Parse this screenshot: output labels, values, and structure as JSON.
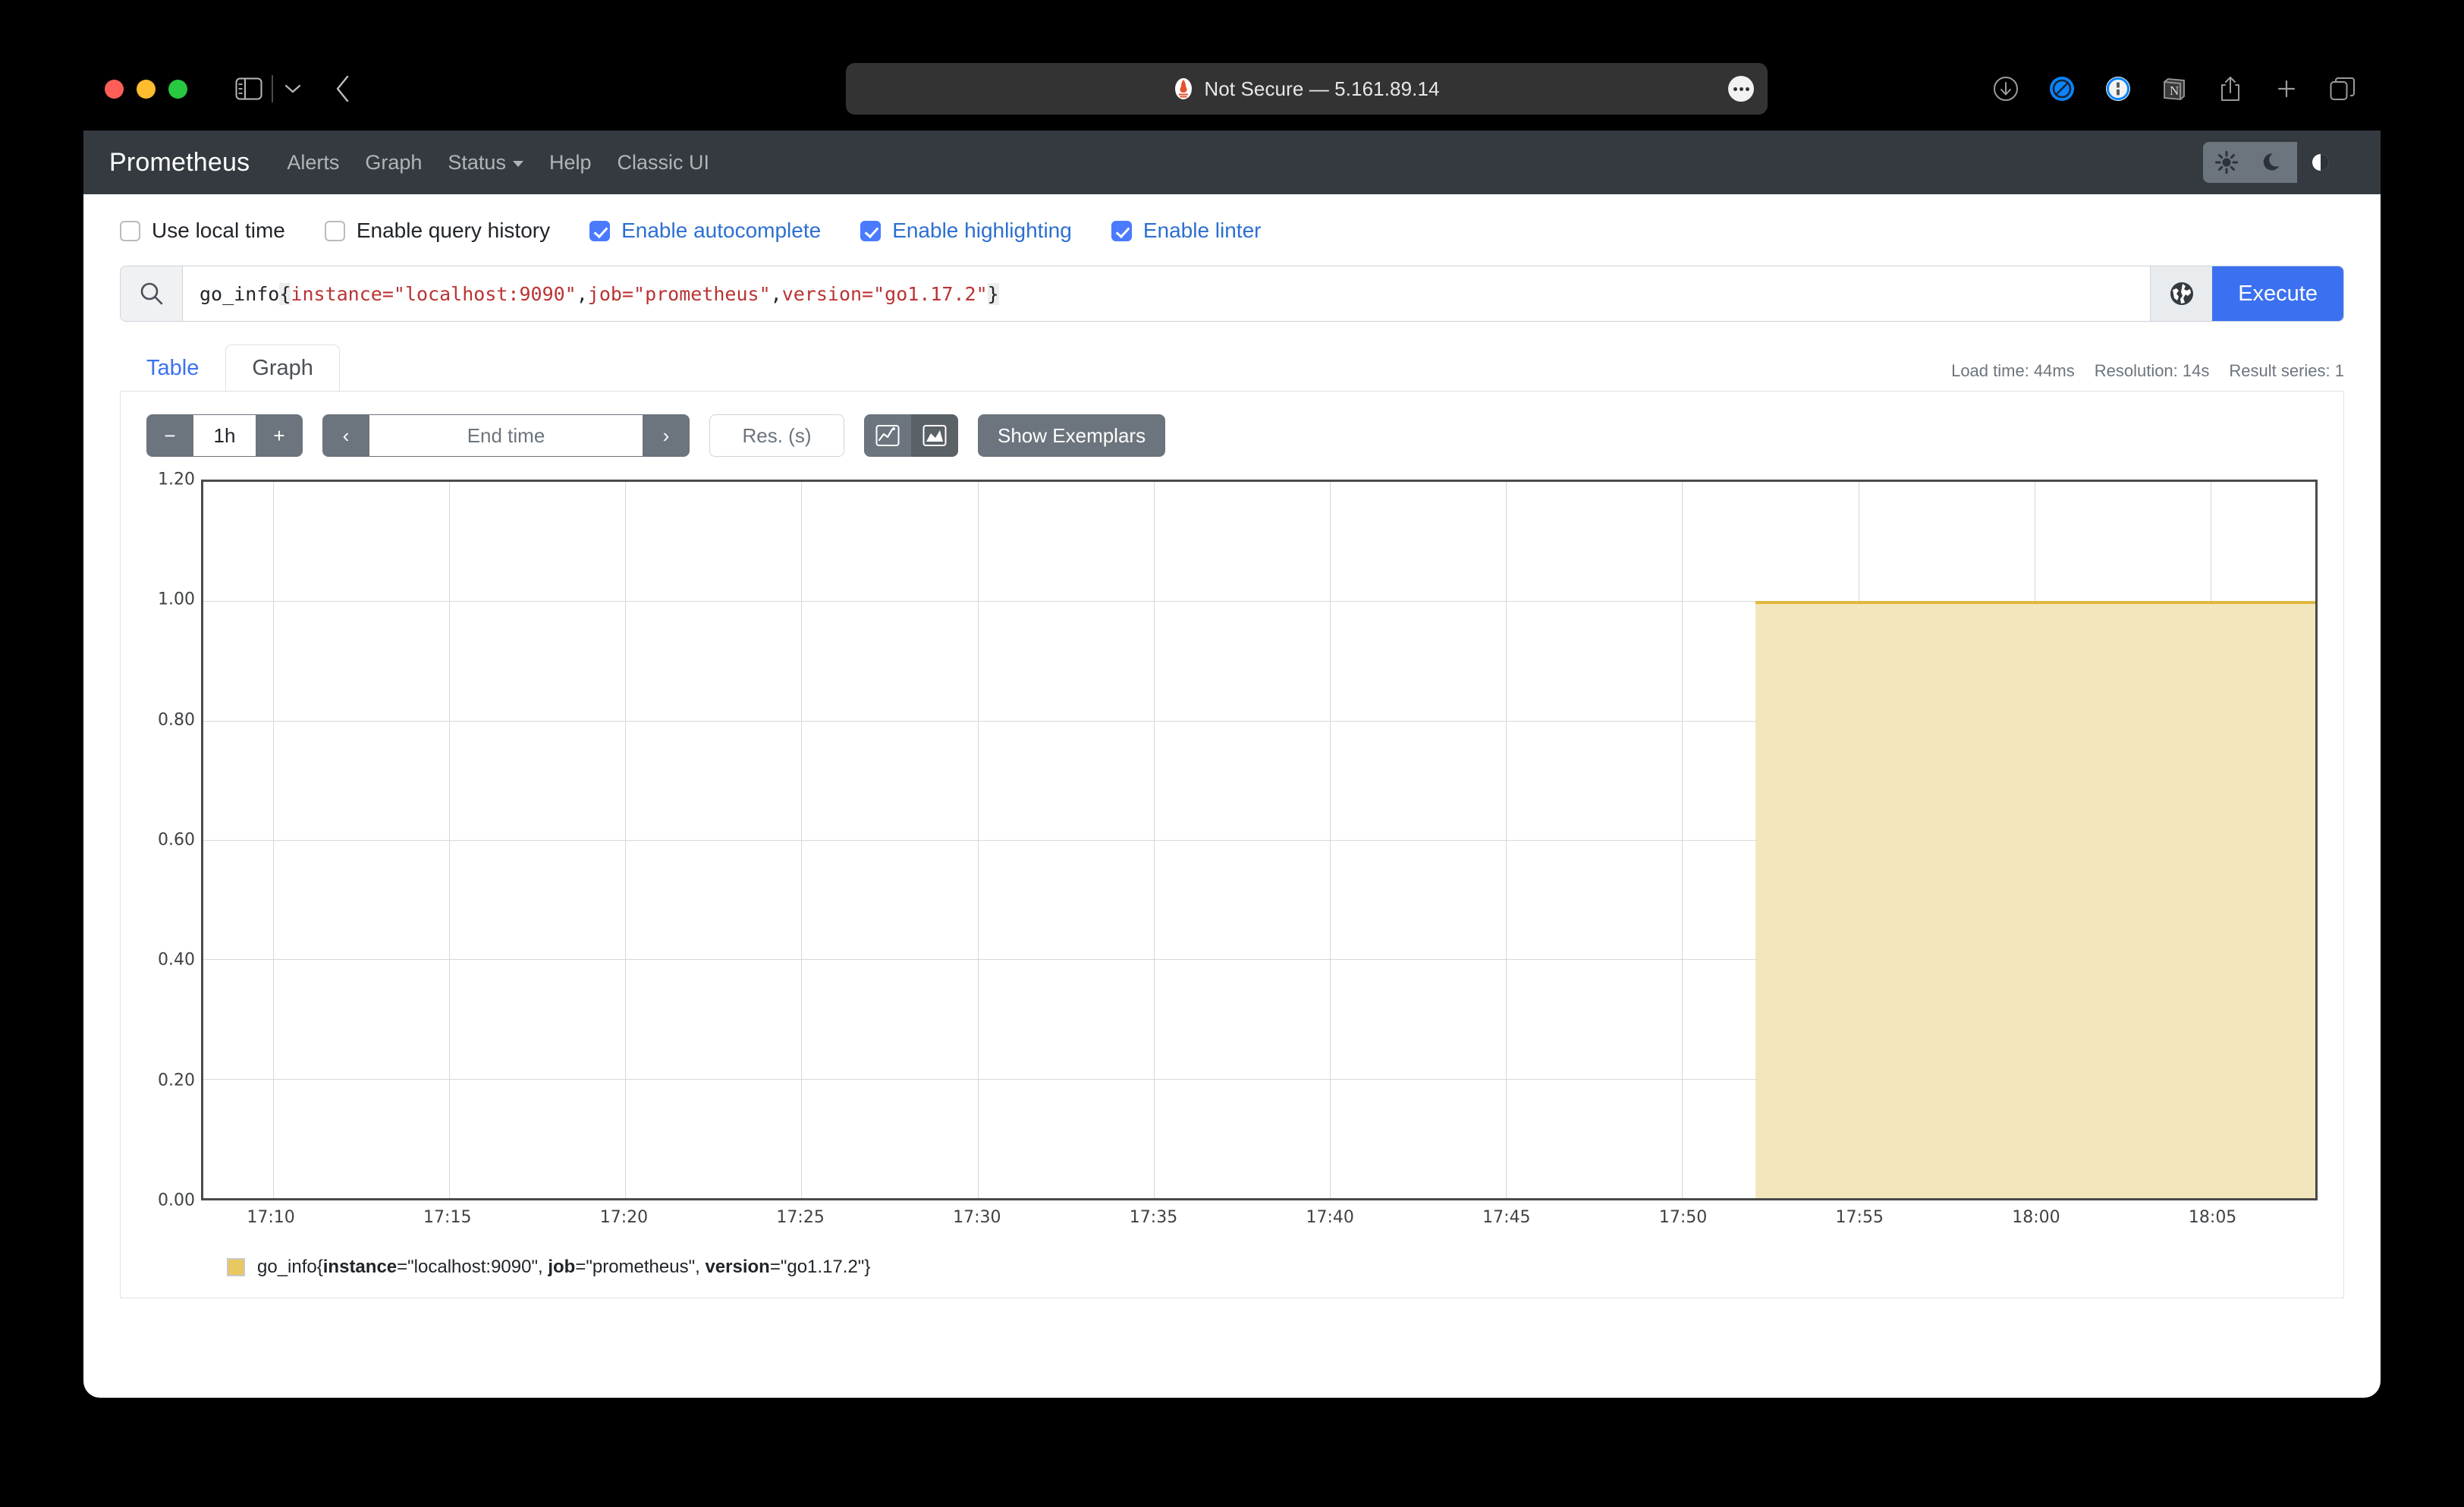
{
  "browser": {
    "url_label": "Not Secure — 5.161.89.14",
    "favicon_name": "prometheus-favicon",
    "toolbar_icons": [
      "download-icon",
      "adblock-icon",
      "1password-icon",
      "notion-icon",
      "share-icon",
      "new-tab-icon",
      "tab-overview-icon"
    ],
    "left_icons": [
      "sidebar-toggle-icon",
      "tab-group-chevron-icon",
      "back-arrow-icon"
    ]
  },
  "navbar": {
    "brand": "Prometheus",
    "links": [
      {
        "label": "Alerts",
        "caret": false
      },
      {
        "label": "Graph",
        "caret": false
      },
      {
        "label": "Status",
        "caret": true
      },
      {
        "label": "Help",
        "caret": false
      },
      {
        "label": "Classic UI",
        "caret": false
      }
    ],
    "theme_buttons": [
      {
        "name": "light-theme-button",
        "icon": "sun-icon",
        "active": false
      },
      {
        "name": "dark-theme-button",
        "icon": "moon-icon",
        "active": false
      },
      {
        "name": "auto-theme-button",
        "icon": "contrast-icon",
        "active": true
      }
    ]
  },
  "options": [
    {
      "label": "Use local time",
      "checked": false
    },
    {
      "label": "Enable query history",
      "checked": false
    },
    {
      "label": "Enable autocomplete",
      "checked": true
    },
    {
      "label": "Enable highlighting",
      "checked": true
    },
    {
      "label": "Enable linter",
      "checked": true
    }
  ],
  "query": {
    "full_text": "go_info{instance=\"localhost:9090\", job=\"prometheus\", version=\"go1.17.2\"}",
    "metric": "go_info",
    "open_brace": "{",
    "close_brace": "}",
    "tokens": [
      {
        "name": "instance",
        "op": "=",
        "value": "\"localhost:9090\""
      },
      {
        "name": "job",
        "op": "=",
        "value": "\"prometheus\""
      },
      {
        "name": "version",
        "op": "=",
        "value": "\"go1.17.2\""
      }
    ],
    "separator": ", ",
    "search_icon": "search-icon",
    "globe_icon": "globe-icon",
    "execute_label": "Execute"
  },
  "tabs": [
    {
      "label": "Table",
      "active": false
    },
    {
      "label": "Graph",
      "active": true
    }
  ],
  "stats": {
    "load_time": "Load time: 44ms",
    "resolution": "Resolution: 14s",
    "result_series": "Result series: 1"
  },
  "controls": {
    "decrease_label": "−",
    "range_value": "1h",
    "increase_label": "+",
    "prev_label": "‹",
    "end_time_placeholder": "End time",
    "next_label": "›",
    "res_placeholder": "Res. (s)",
    "line_chart_icon": "line-chart-icon",
    "stacked_chart_icon": "stacked-chart-icon",
    "stacked_active": true,
    "show_exemplars_label": "Show Exemplars"
  },
  "chart_data": {
    "type": "area",
    "title": "",
    "xlabel": "",
    "ylabel": "",
    "ylim": [
      0.0,
      1.2
    ],
    "yticks": [
      0.0,
      0.2,
      0.4,
      0.6,
      0.8,
      1.0,
      1.2
    ],
    "ytick_labels": [
      "0.00",
      "0.20",
      "0.40",
      "0.60",
      "0.80",
      "1.00",
      "1.20"
    ],
    "xtick_labels": [
      "17:10",
      "17:15",
      "17:20",
      "17:25",
      "17:30",
      "17:35",
      "17:40",
      "17:45",
      "17:50",
      "17:55",
      "18:00",
      "18:05"
    ],
    "x_range": [
      "17:08",
      "18:08"
    ],
    "grid": true,
    "legend_position": "bottom-left",
    "series": [
      {
        "name": "go_info{instance=\"localhost:9090\", job=\"prometheus\", version=\"go1.17.2\"}",
        "color": "#e8c860",
        "fill_color": "#f2e7bc",
        "line_color": "#dfb73f",
        "start_time": "17:53",
        "end_time": "18:08",
        "value": 1.0,
        "note": "Constant value 1 from 17:53 onwards; no data before"
      }
    ]
  },
  "legend": {
    "metric": "go_info{",
    "close": "}",
    "entries": [
      {
        "key": "instance",
        "value": "=\"localhost:9090\", "
      },
      {
        "key": "job",
        "value": "=\"prometheus\", "
      },
      {
        "key": "version",
        "value": "=\"go1.17.2\""
      }
    ]
  }
}
